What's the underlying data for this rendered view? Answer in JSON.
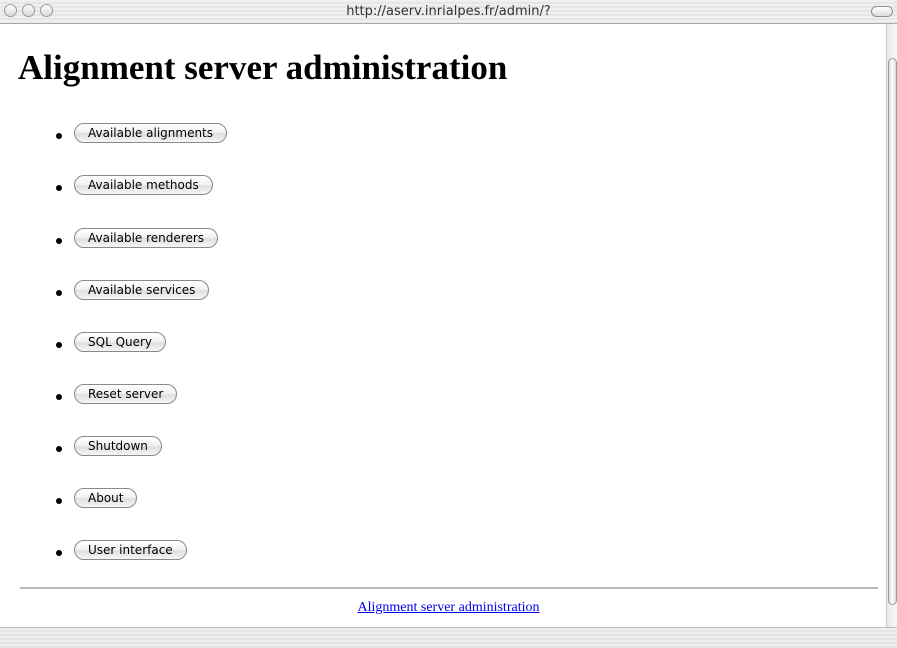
{
  "window": {
    "title": "http://aserv.inrialpes.fr/admin/?"
  },
  "page": {
    "heading": "Alignment server administration"
  },
  "menu": {
    "items": [
      {
        "label": "Available alignments"
      },
      {
        "label": "Available methods"
      },
      {
        "label": "Available renderers"
      },
      {
        "label": "Available services"
      },
      {
        "label": "SQL Query"
      },
      {
        "label": "Reset server"
      },
      {
        "label": "Shutdown"
      },
      {
        "label": "About"
      },
      {
        "label": "User interface"
      }
    ]
  },
  "footer": {
    "link_text": "Alignment server administration"
  },
  "colors": {
    "link": "#0000ee",
    "rule": "#b8b8b8"
  }
}
